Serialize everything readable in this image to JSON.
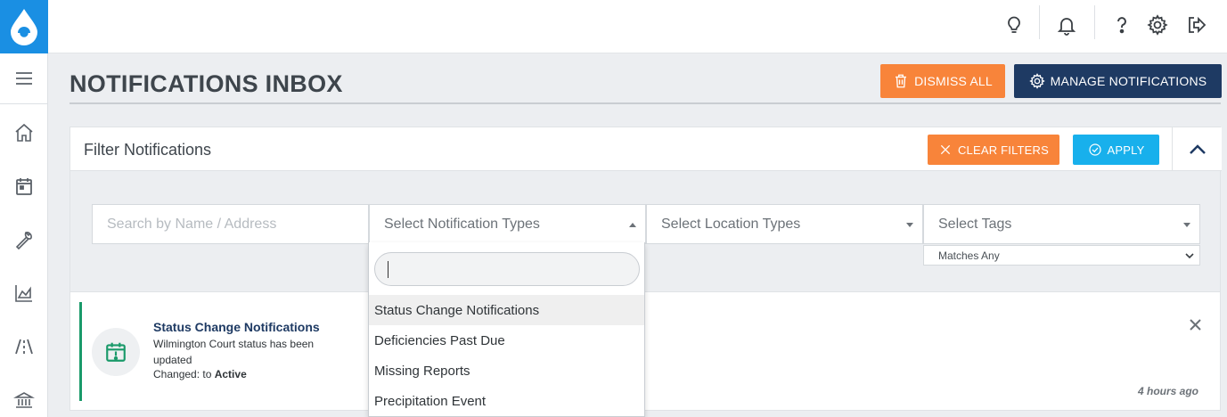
{
  "header": {
    "icons": [
      "lightbulb-icon",
      "bell-icon",
      "help-icon",
      "gear-icon",
      "sign-out-icon"
    ]
  },
  "sidebar": {
    "icons": [
      "hamburger-menu-icon",
      "home-icon",
      "calendar-icon",
      "wrench-icon",
      "chart-icon",
      "road-icon",
      "bank-icon"
    ]
  },
  "page": {
    "title": "NOTIFICATIONS INBOX",
    "dismiss_all_label": "DISMISS ALL",
    "manage_label": "MANAGE NOTIFICATIONS"
  },
  "filters": {
    "title": "Filter Notifications",
    "clear_label": "CLEAR FILTERS",
    "apply_label": "APPLY",
    "search_placeholder": "Search by Name / Address",
    "notification_types_placeholder": "Select Notification Types",
    "location_types_placeholder": "Select Location Types",
    "tags_placeholder": "Select Tags",
    "tags_match_mode": "Matches Any"
  },
  "dropdown": {
    "search_value": "",
    "options": [
      "Status Change Notifications",
      "Deficiencies Past Due",
      "Missing Reports",
      "Precipitation Event"
    ],
    "highlighted_index": 0
  },
  "notification": {
    "title": "Status Change Notifications",
    "body": "Wilmington Court status has been updated",
    "change_prefix": "Changed: to ",
    "change_value": "Active",
    "time": "4 hours ago"
  },
  "colors": {
    "brand_blue": "#1a8fe3",
    "orange": "#f8843a",
    "navy": "#1e3a63",
    "cyan": "#18b0ec",
    "green": "#1a9a6a"
  }
}
